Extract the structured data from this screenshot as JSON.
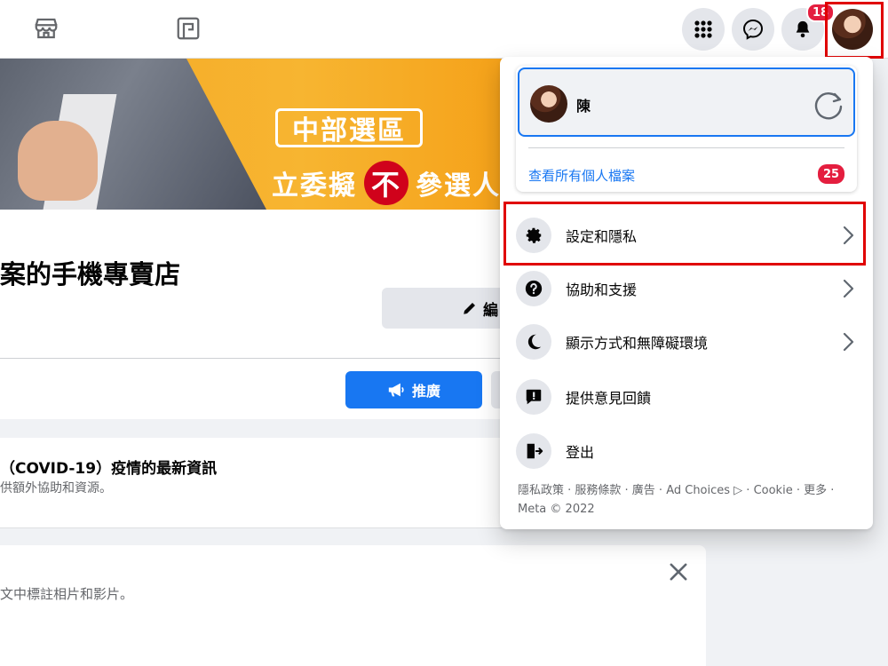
{
  "topnav": {
    "notification_count": "18"
  },
  "cover": {
    "region_text": "中部選區",
    "headline_left": "立委擬",
    "headline_mark": "不",
    "headline_right": "參選人"
  },
  "page": {
    "title": "案的手機專賣店",
    "edit_label": "編",
    "promote_label": "推廣"
  },
  "covid_card": {
    "title": "（COVID-19）疫情的最新資訊",
    "subtitle": "供額外協助和資源。"
  },
  "tag_card": {
    "subtitle": "文中標註相片和影片。"
  },
  "dropdown": {
    "profile_name": "陳",
    "view_all_label": "查看所有個人檔案",
    "view_all_count": "25",
    "items": [
      {
        "label": "設定和隱私"
      },
      {
        "label": "協助和支援"
      },
      {
        "label": "顯示方式和無障礙環境"
      },
      {
        "label": "提供意見回饋"
      },
      {
        "label": "登出"
      }
    ],
    "footer": "隱私政策 · 服務條款 · 廣告 · Ad Choices ▷ · Cookie · 更多 · Meta © 2022"
  },
  "colors": {
    "accent": "#1877f2",
    "badge": "#e41e3f",
    "highlight": "#e00000"
  }
}
